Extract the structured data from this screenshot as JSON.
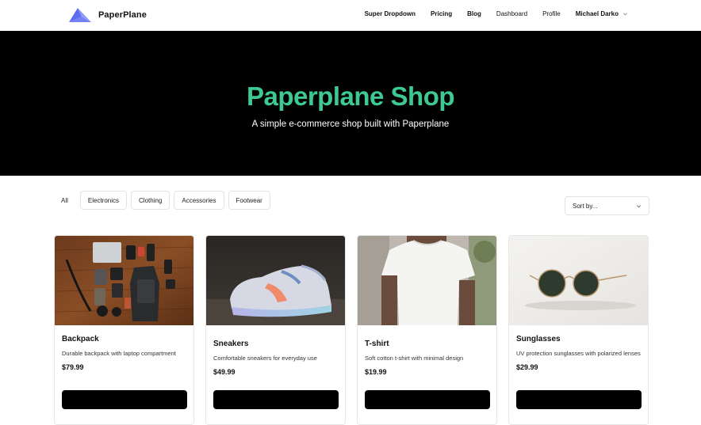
{
  "brand": {
    "name": "PaperPlane",
    "accent": "#6e7bf2"
  },
  "nav": {
    "links": [
      "Super Dropdown",
      "Pricing",
      "Blog",
      "Dashboard",
      "Profile"
    ],
    "user": "Michael Darko"
  },
  "hero": {
    "title": "Paperplane Shop",
    "subtitle": "A simple e-commerce shop built with Paperplane",
    "title_color": "#3ec993"
  },
  "filters": [
    "All",
    "Electronics",
    "Clothing",
    "Accessories",
    "Footwear"
  ],
  "sort": {
    "placeholder": "Sort by..."
  },
  "products": [
    {
      "name": "Backpack",
      "description": "Durable backpack with laptop compartment",
      "price": "$79.99"
    },
    {
      "name": "Sneakers",
      "description": "Comfortable sneakers for everyday use",
      "price": "$49.99"
    },
    {
      "name": "T-shirt",
      "description": "Soft cotton t-shirt with minimal design",
      "price": "$19.99"
    },
    {
      "name": "Sunglasses",
      "description": "UV protection sunglasses with polarized lenses",
      "price": "$29.99"
    }
  ]
}
